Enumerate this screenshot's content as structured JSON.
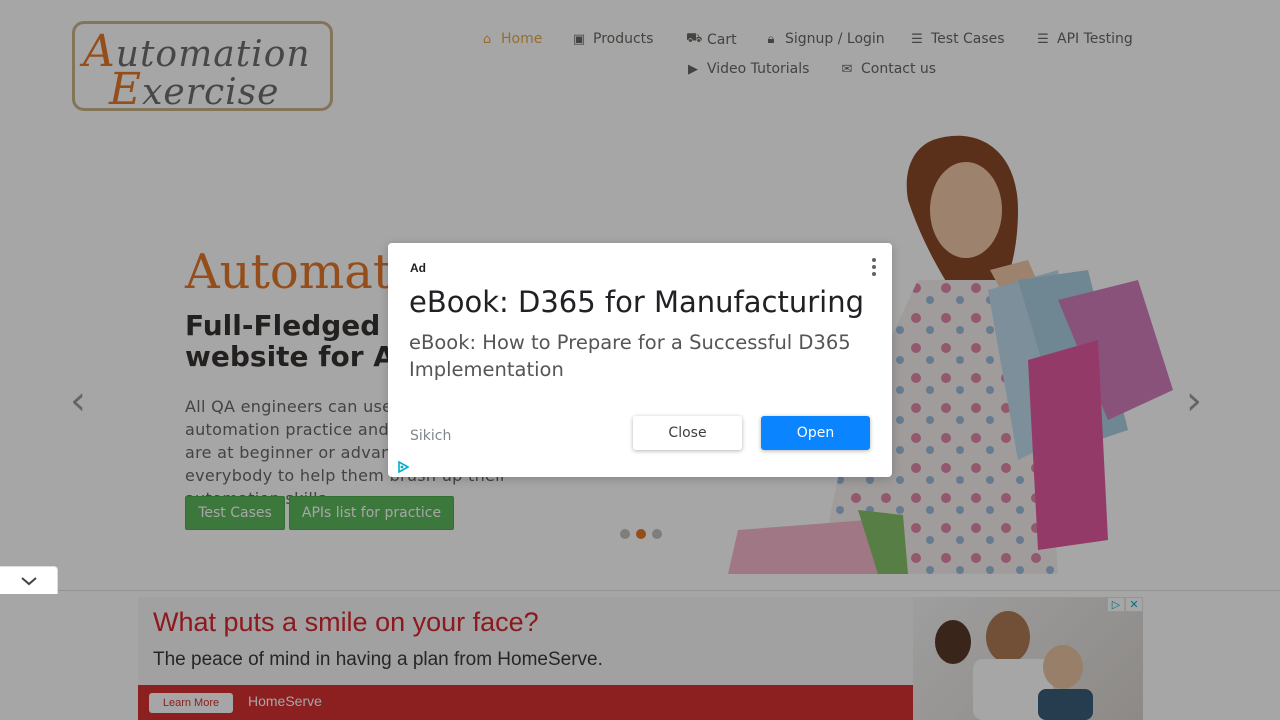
{
  "logo": {
    "line1_cap": "A",
    "line1_rest": "utomation",
    "line2_cap": "E",
    "line2_rest": "xercise"
  },
  "nav": {
    "items": [
      {
        "label": "Home",
        "icon": "home-icon",
        "active": true
      },
      {
        "label": "Products",
        "icon": "briefcase-icon"
      },
      {
        "label": "Cart",
        "icon": "cart-icon"
      },
      {
        "label": "Signup / Login",
        "icon": "lock-icon"
      },
      {
        "label": "Test Cases",
        "icon": "list-icon"
      },
      {
        "label": "API Testing",
        "icon": "list-icon"
      },
      {
        "label": "Video Tutorials",
        "icon": "youtube-icon"
      },
      {
        "label": "Contact us",
        "icon": "envelope-icon"
      }
    ]
  },
  "hero": {
    "title": "Automat",
    "subtitle": "Full-Fledged practice website for Automatio",
    "text": "All QA engineers can use this website for automation practice and API testing either they are at beginner or advance level. This is for everybody to help them brush up their automation skills.",
    "btn_test_cases": "Test Cases",
    "btn_apis": "APIs list for practice",
    "prev": "‹",
    "next": "›"
  },
  "modal": {
    "ad_label": "Ad",
    "title": "eBook: D365 for Manufacturing",
    "body": "eBook: How to Prepare for a Successful D365 Implementation",
    "advertiser": "Sikich",
    "close_label": "Close",
    "open_label": "Open"
  },
  "bottom_ad": {
    "headline": "What puts a smile on your face?",
    "subline": "The peace of mind in having a plan from HomeServe.",
    "learn_more": "Learn More",
    "brand": "HomeServe"
  },
  "colors": {
    "accent": "#e4782a",
    "green": "#5cb85c",
    "open_blue": "#0a84ff"
  }
}
